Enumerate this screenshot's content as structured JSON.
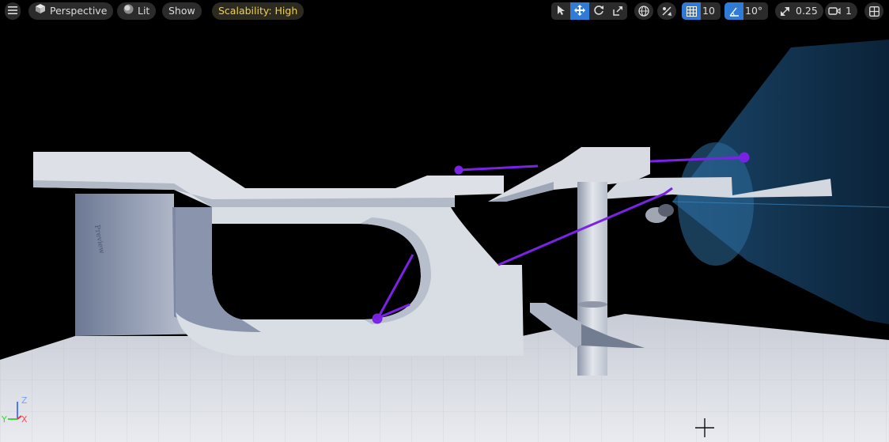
{
  "toolbar": {
    "view_mode": "Perspective",
    "lighting": "Lit",
    "show": "Show",
    "scalability": "Scalability: High",
    "grid_snap": "10",
    "rotation_snap": "10°",
    "scale_snap": "0.25",
    "camera_speed": "1"
  },
  "gizmo": {
    "z": "Z",
    "y": "Y",
    "x": "X"
  },
  "icons": {
    "menu": "hamburger-menu-icon",
    "perspective": "cube-icon",
    "lit": "sphere-icon",
    "select": "cursor-arrow-icon",
    "translate": "move-arrows-icon",
    "rotate": "rotate-icon",
    "scale": "scale-icon",
    "world": "globe-icon",
    "surface_snap": "surface-snap-icon",
    "grid": "grid-icon",
    "angle": "angle-icon",
    "scale_snap": "scale-arrow-icon",
    "camera": "camera-icon",
    "layout": "viewport-layout-icon"
  },
  "colors": {
    "accent": "#2f7bd6",
    "scalability_text": "#f2d14a",
    "spline": "#7a22e6",
    "light_cone": "#1e5a8a"
  }
}
